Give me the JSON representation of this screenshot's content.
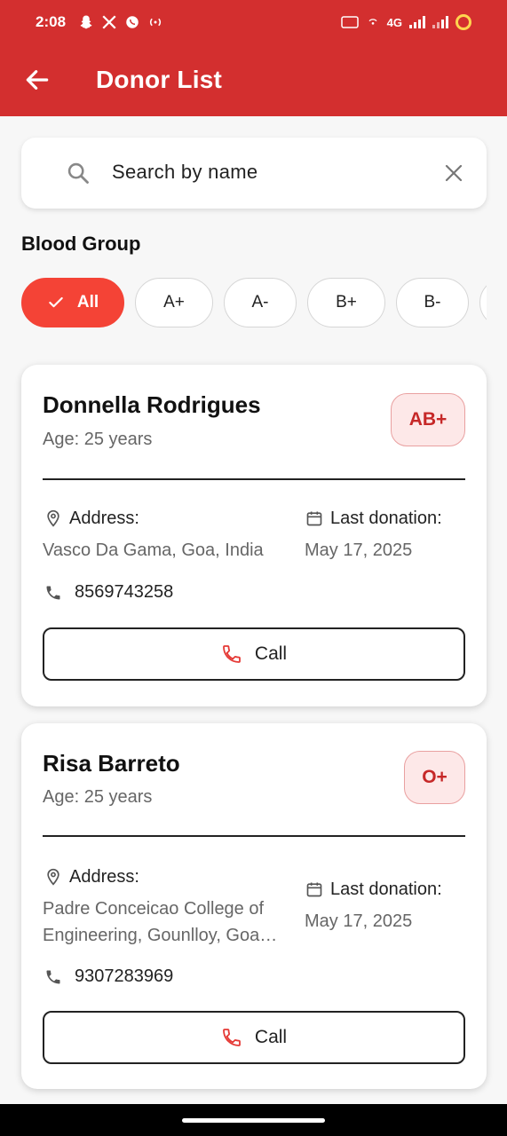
{
  "status": {
    "time": "2:08",
    "network": "4G"
  },
  "header": {
    "title": "Donor List"
  },
  "search": {
    "placeholder": "Search by name"
  },
  "filters": {
    "label": "Blood Group",
    "chips": [
      "All",
      "A+",
      "A-",
      "B+",
      "B-"
    ]
  },
  "donors": [
    {
      "name": "Donnella Rodrigues",
      "age": "Age: 25 years",
      "blood_group": "AB+",
      "address_label": "Address:",
      "address": "Vasco Da Gama, Goa, India",
      "last_donation_label": "Last donation:",
      "last_donation": "May 17, 2025",
      "phone": "8569743258",
      "call_label": "Call"
    },
    {
      "name": "Risa Barreto",
      "age": "Age: 25 years",
      "blood_group": "O+",
      "address_label": "Address:",
      "address_line1": "Padre Conceicao College of",
      "address_line2": "Engineering, Gounlloy, Goa…",
      "last_donation_label": "Last donation:",
      "last_donation": "May 17, 2025",
      "phone": "9307283969",
      "call_label": "Call"
    }
  ],
  "colors": {
    "primary": "#d32f2f",
    "chip_active": "#f44336",
    "badge_bg": "#fde8e8",
    "badge_text": "#c62828"
  }
}
